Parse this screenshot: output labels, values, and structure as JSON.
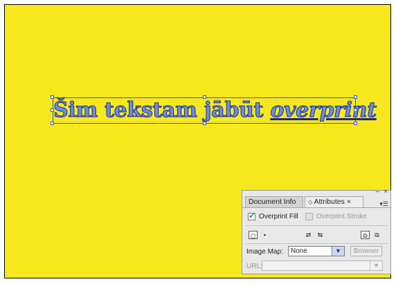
{
  "artboard": {
    "text_normal": "Šim tekstam jābūt ",
    "text_overprint": "overprint"
  },
  "panel": {
    "tab_document_info": "Document Info",
    "tab_attributes": "Attributes",
    "tab_attributes_icon": "◇",
    "tab_close": "×",
    "panel_minimize": "‒",
    "panel_close": "×",
    "panel_menu": "▾☰",
    "overprint_fill_label": "Overprint Fill",
    "overprint_fill_checked": true,
    "overprint_stroke_label": "Overprint Stroke",
    "overprint_stroke_checked": false,
    "image_map_label": "Image Map:",
    "image_map_value": "None",
    "browser_button": "Browser",
    "url_label": "URL:",
    "url_value": ""
  }
}
